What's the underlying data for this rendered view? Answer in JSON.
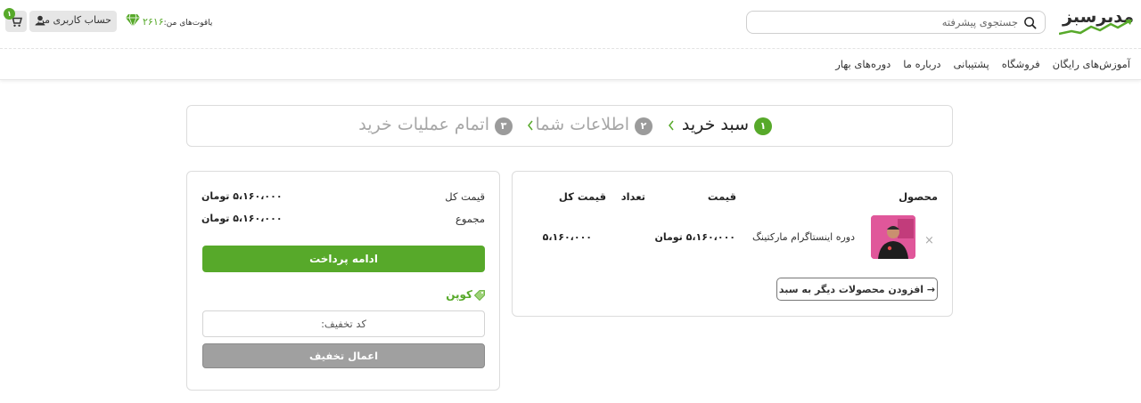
{
  "header": {
    "logo_text": "مدیرسبز",
    "search_placeholder": "جستجوی پیشرفته",
    "account_label": "حساب کاربری من",
    "gems_label": "یاقوت‌های من:",
    "gems_value": "۲۶۱۶",
    "cart_count": "۱"
  },
  "nav": {
    "items": [
      {
        "label": "آموزش‌های رایگان"
      },
      {
        "label": "فروشگاه"
      },
      {
        "label": "پشتیبانی"
      },
      {
        "label": "درباره ما"
      },
      {
        "label": "دوره‌های بهار"
      }
    ]
  },
  "steps": [
    {
      "num": "۱",
      "label": "سبد خرید",
      "state": "active"
    },
    {
      "num": "۲",
      "label": "اطلاعات شما",
      "state": "inactive"
    },
    {
      "num": "۳",
      "label": "اتمام عملیات خرید",
      "state": "inactive"
    }
  ],
  "cart": {
    "columns": {
      "product": "محصول",
      "price": "قیمت",
      "quantity": "تعداد",
      "total": "قیمت کل"
    },
    "items": [
      {
        "name": "دوره اینستاگرام مارکتینگ",
        "price": "۵،۱۶۰،۰۰۰ تومان",
        "total": "۵،۱۶۰،۰۰۰"
      }
    ],
    "remove_glyph": "×",
    "add_more_label": "→ افزودن محصولات دیگر به سبد"
  },
  "totals": {
    "subtotal_label": "قیمت کل",
    "subtotal_value": "۵،۱۶۰،۰۰۰ تومان",
    "total_label": "مجموع",
    "total_value": "۵،۱۶۰،۰۰۰ تومان",
    "pay_label": "ادامه پرداخت",
    "coupon_title": "کوپن",
    "coupon_placeholder": "کد تخفیف:",
    "apply_label": "اعمال تخفیف"
  },
  "colors": {
    "accent": "#57a92a",
    "muted": "#a6a6a6",
    "button_gray": "#a0a0a0"
  }
}
